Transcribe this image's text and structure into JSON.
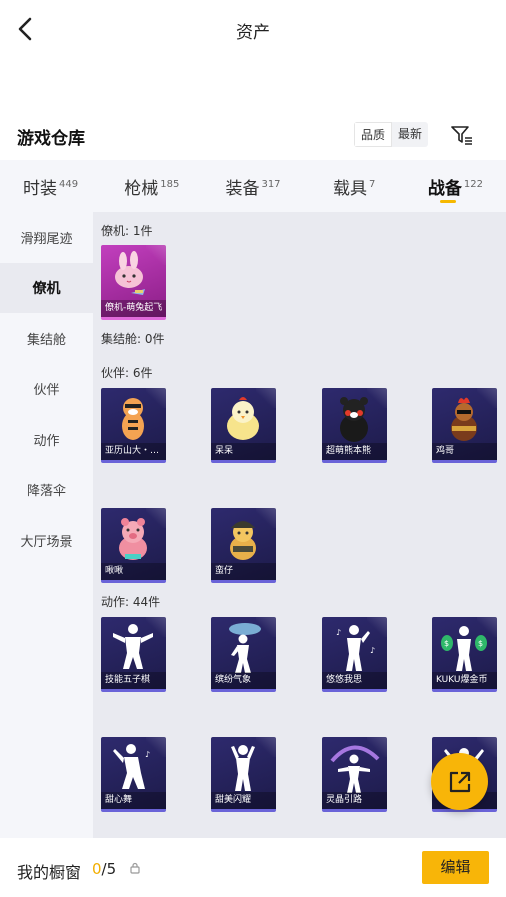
{
  "header": {
    "title": "资产"
  },
  "section": {
    "title": "游戏仓库",
    "sort_options": [
      "品质",
      "最新"
    ]
  },
  "tabs": [
    {
      "label": "时装",
      "count": "449"
    },
    {
      "label": "枪械",
      "count": "185"
    },
    {
      "label": "装备",
      "count": "317"
    },
    {
      "label": "载具",
      "count": "7"
    },
    {
      "label": "战备",
      "count": "122"
    }
  ],
  "sidebar": [
    "滑翔尾迹",
    "僚机",
    "集结舱",
    "伙伴",
    "动作",
    "降落伞",
    "大厅场景"
  ],
  "groups": {
    "wingman": {
      "label": "僚机: 1件",
      "items": [
        "僚机-萌兔起飞"
      ]
    },
    "capsule": {
      "label": "集结舱: 0件"
    },
    "partner": {
      "label": "伙伴: 6件",
      "items": [
        "亚历山大・赵...",
        "呆呆",
        "超萌熊本熊",
        "鸡哥",
        "啾啾",
        "蛮仔"
      ]
    },
    "emote": {
      "label": "动作: 44件",
      "items": [
        "技能五子棋",
        "缤纷气象",
        "悠悠我思",
        "KUKU爆金币",
        "甜心舞",
        "甜美闪耀",
        "灵晶引路",
        ""
      ]
    }
  },
  "bottom": {
    "label": "我的橱窗",
    "count_current": "0",
    "count_total": "/5",
    "edit_label": "编辑"
  },
  "colors": {
    "accent": "#f8b508",
    "card_bg": "#2a2766",
    "card_pink": "#b734b3"
  },
  "icons": [
    "back-arrow-icon",
    "filter-icon",
    "lock-icon",
    "share-icon"
  ]
}
